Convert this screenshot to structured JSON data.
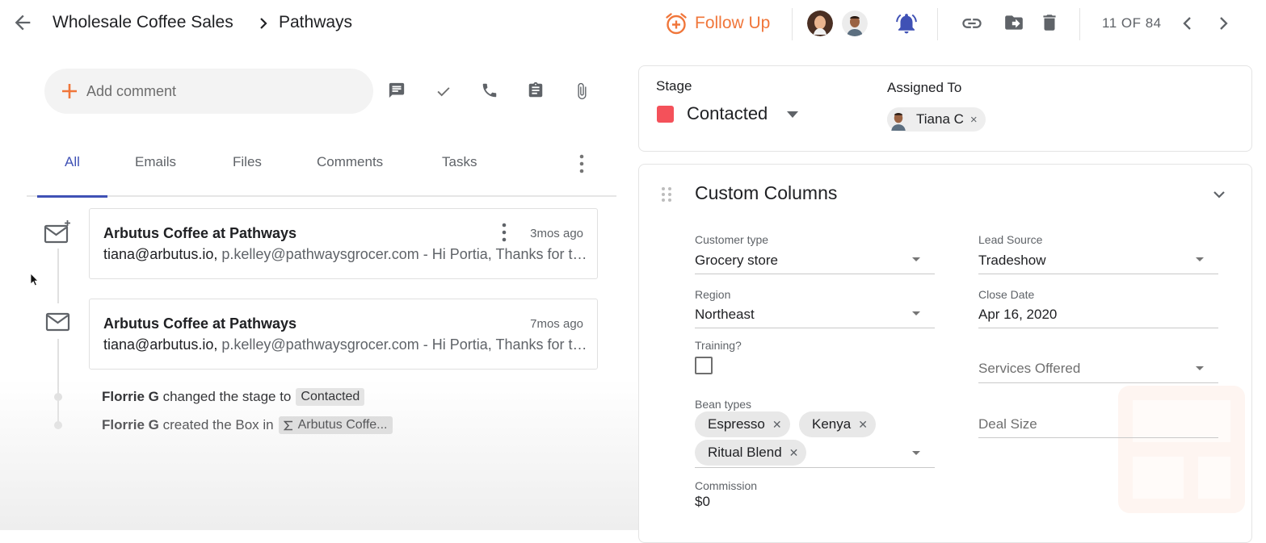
{
  "header": {
    "breadcrumb_root": "Wholesale Coffee Sales",
    "breadcrumb_current": "Pathways",
    "follow_up_label": "Follow Up",
    "counter": "11 OF 84",
    "accent_color": "#f0763a"
  },
  "composer": {
    "placeholder": "Add comment",
    "tools": [
      "chat-icon",
      "check-icon",
      "phone-icon",
      "clipboard-icon",
      "attach-icon"
    ]
  },
  "tabs": [
    {
      "label": "All",
      "active": true
    },
    {
      "label": "Emails",
      "active": false
    },
    {
      "label": "Files",
      "active": false
    },
    {
      "label": "Comments",
      "active": false
    },
    {
      "label": "Tasks",
      "active": false
    }
  ],
  "timeline": {
    "emails": [
      {
        "subject": "Arbutus Coffee at Pathways",
        "time": "3mos ago",
        "from": "tiana@arbutus.io,",
        "rest": "p.kelley@pathwaysgrocer.com - Hi Portia, Thanks for taking the time"
      },
      {
        "subject": "Arbutus Coffee at Pathways",
        "time": "7mos ago",
        "from": "tiana@arbutus.io,",
        "rest": "p.kelley@pathwaysgrocer.com - Hi Portia, Thanks for taking the time"
      }
    ],
    "events": [
      {
        "actor": "Florrie G",
        "text": "changed the stage to",
        "chip": "Contacted"
      },
      {
        "actor": "Florrie G",
        "text": "created the Box in",
        "chip": "Arbutus Coffe..."
      }
    ]
  },
  "stage": {
    "label": "Stage",
    "value": "Contacted",
    "color": "#f4515a"
  },
  "assigned": {
    "label": "Assigned To",
    "name": "Tiana C",
    "remove": "×"
  },
  "custom_columns": {
    "title": "Custom Columns",
    "customer_type": {
      "label": "Customer type",
      "value": "Grocery store"
    },
    "lead_source": {
      "label": "Lead Source",
      "value": "Tradeshow"
    },
    "region": {
      "label": "Region",
      "value": "Northeast"
    },
    "close_date": {
      "label": "Close Date",
      "value": "Apr 16, 2020"
    },
    "training": {
      "label": "Training?",
      "checked": false
    },
    "services_offered": {
      "label": "Services Offered"
    },
    "bean_types": {
      "label": "Bean types",
      "values": [
        "Espresso",
        "Kenya",
        "Ritual Blend"
      ]
    },
    "deal_size": {
      "label": "Deal Size"
    },
    "commission": {
      "label": "Commission",
      "value": "$0"
    }
  }
}
